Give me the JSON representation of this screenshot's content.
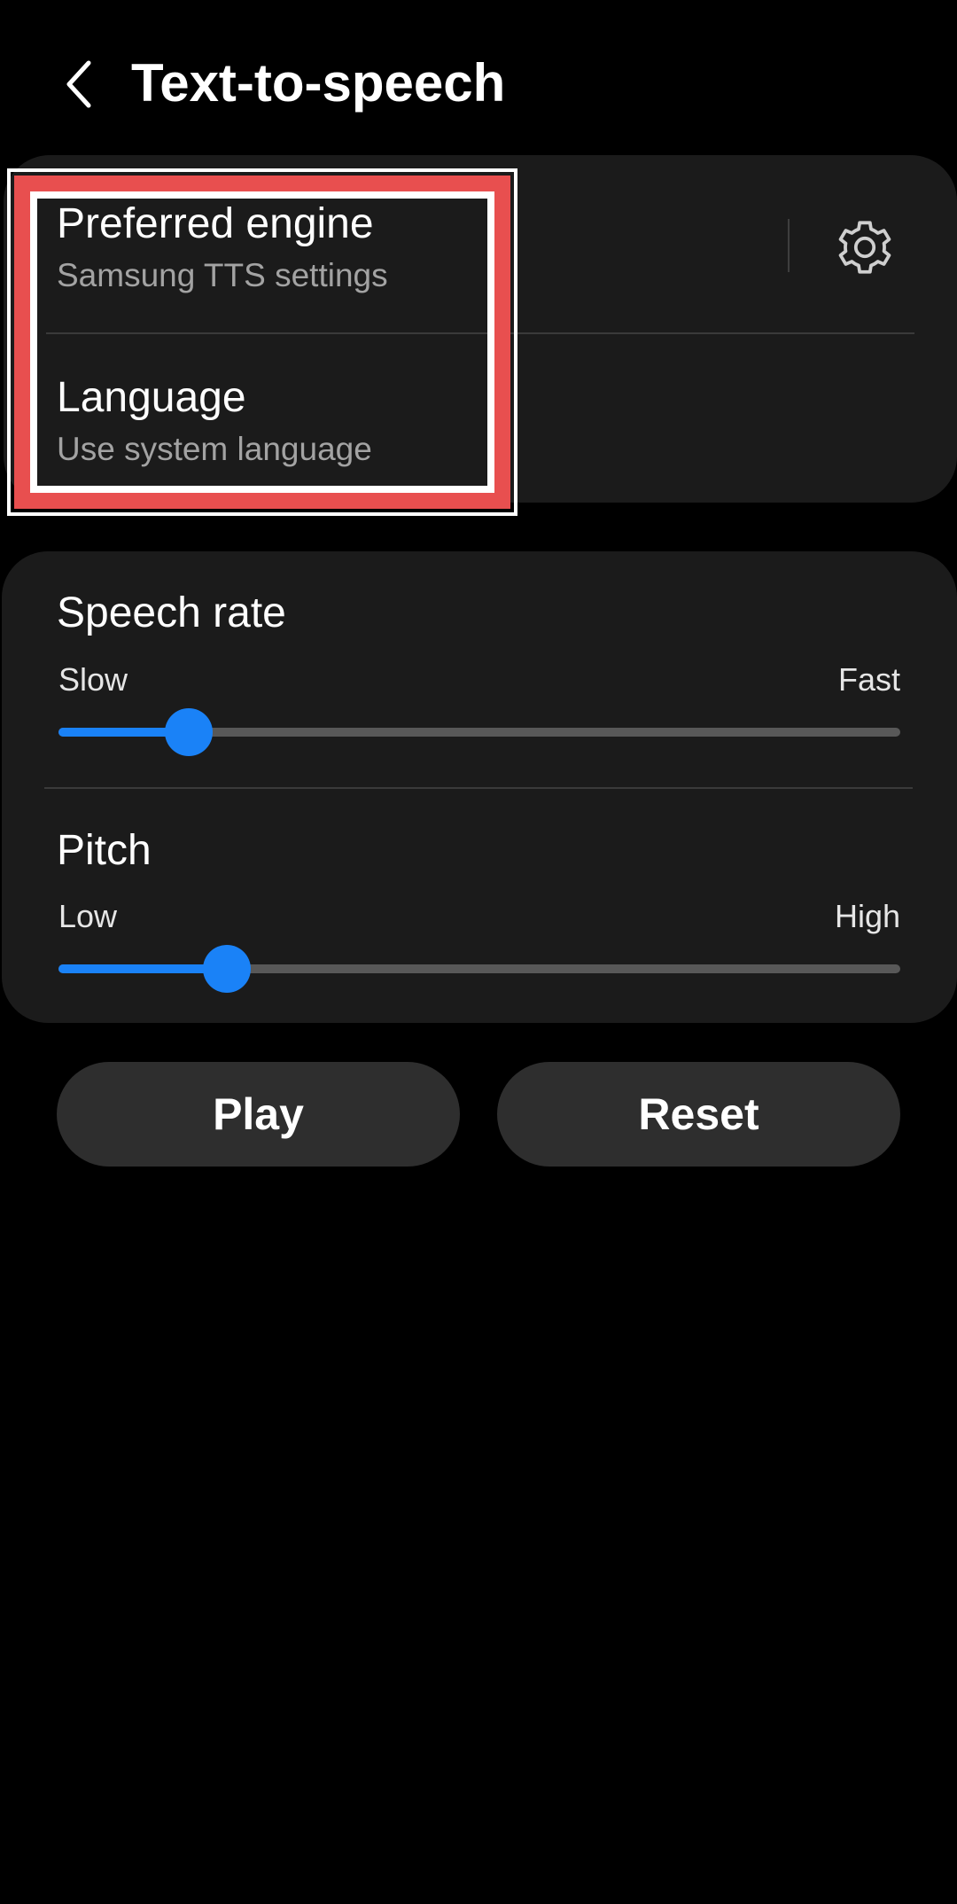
{
  "header": {
    "back_icon": "chevron-left-icon",
    "title": "Text-to-speech"
  },
  "engine_card": {
    "preferred_engine": {
      "title": "Preferred engine",
      "subtitle": "Samsung TTS settings",
      "settings_icon": "gear-icon"
    },
    "language": {
      "title": "Language",
      "subtitle": "Use system language"
    }
  },
  "sliders": {
    "speech_rate": {
      "title": "Speech rate",
      "min_label": "Slow",
      "max_label": "Fast",
      "level_fraction": 0.155
    },
    "pitch": {
      "title": "Pitch",
      "min_label": "Low",
      "max_label": "High",
      "level_fraction": 0.2
    }
  },
  "buttons": {
    "play_label": "Play",
    "reset_label": "Reset"
  },
  "colors": {
    "accent": "#1a82f7",
    "highlight": "#e84f4f",
    "card_background": "#1b1b1b",
    "button_background": "#2e2e2e"
  }
}
